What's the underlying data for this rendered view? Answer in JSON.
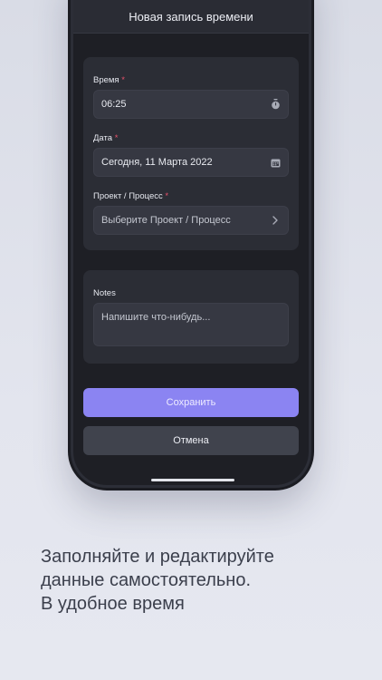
{
  "header": {
    "title": "Новая запись времени"
  },
  "form": {
    "time": {
      "label": "Время",
      "required_mark": "*",
      "value": "06:25",
      "icon": "stopwatch-icon"
    },
    "date": {
      "label": "Дата",
      "required_mark": "*",
      "value": "Сегодня, 11 Марта 2022",
      "icon": "calendar-icon"
    },
    "project": {
      "label": "Проект / Процесс",
      "required_mark": "*",
      "value": "Выберите Проект / Процесс",
      "icon": "chevron-right-icon"
    }
  },
  "notes": {
    "label": "Notes",
    "placeholder": "Напишите что-нибудь..."
  },
  "buttons": {
    "save": "Сохранить",
    "cancel": "Отмена"
  },
  "caption": {
    "line1": "Заполняйте и редактируйте",
    "line2": "данные самостоятельно.",
    "line3": "В удобное время"
  },
  "colors": {
    "accent": "#8b84f2",
    "required": "#e8526b",
    "background": "#1e1f25"
  }
}
